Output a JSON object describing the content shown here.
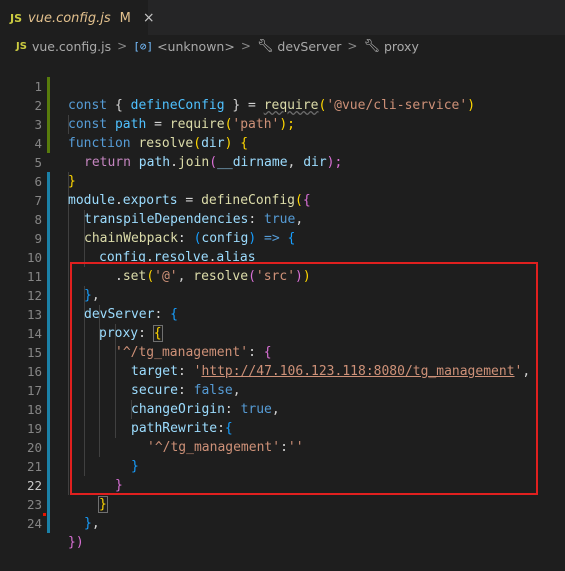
{
  "tab": {
    "badge": "JS",
    "title": "vue.config.js",
    "status": "M",
    "close": "×"
  },
  "breadcrumb": {
    "badge": "JS",
    "file": "vue.config.js",
    "sep": ">",
    "unknown_icon": "[⊘]",
    "unknown": "<unknown>",
    "devserver": "devServer",
    "proxy": "proxy"
  },
  "lines": [
    "1",
    "2",
    "3",
    "4",
    "5",
    "6",
    "7",
    "8",
    "9",
    "10",
    "11",
    "12",
    "13",
    "14",
    "15",
    "16",
    "17",
    "18",
    "19",
    "20",
    "21",
    "22",
    "23",
    "24"
  ],
  "code": {
    "l1": {
      "const": "const",
      "open": " { ",
      "name": "defineConfig",
      "close": " } ",
      "eq": "= ",
      "req": "require",
      "p1": "(",
      "str": "'@vue/cli-service'",
      "p2": ")"
    },
    "l2": {
      "const": "const",
      "var": " path",
      "eq": " = ",
      "req": "require",
      "p1": "(",
      "str": "'path'",
      "p2": ");"
    },
    "l3": {
      "kw": "function",
      "name": " resolve",
      "p1": "(",
      "arg": "dir",
      "p2": ")",
      "brace": " {"
    },
    "l4": {
      "kw": "return",
      "obj": " path",
      "dot": ".",
      "fn": "join",
      "p1": "(",
      "a1": "__dirname",
      "comma": ", ",
      "a2": "dir",
      "p2": ");"
    },
    "l5": {
      "brace": "}"
    },
    "l6": {
      "mod": "module",
      "dot": ".",
      "exp": "exports",
      "eq": " = ",
      "fn": "defineConfig",
      "p1": "(",
      "b": "{"
    },
    "l7": {
      "key": "transpileDependencies",
      "colon": ": ",
      "val": "true",
      "comma": ","
    },
    "l8": {
      "key": "chainWebpack",
      "colon": ": ",
      "p1": "(",
      "arg": "config",
      "p2": ")",
      "arrow": " => ",
      "b": "{"
    },
    "l9": {
      "obj": "config",
      "d1": ".",
      "p1": "resolve",
      "d2": ".",
      "p2": "alias"
    },
    "l10": {
      "dot": ".",
      "fn": "set",
      "p1": "(",
      "s1": "'@'",
      "comma": ", ",
      "fn2": "resolve",
      "p2": "(",
      "s2": "'src'",
      "p3": ")",
      "p4": ")"
    },
    "l11": {
      "b": "}",
      "comma": ","
    },
    "l12": {
      "key": "devServer",
      "colon": ": ",
      "b": "{"
    },
    "l13": {
      "key": "proxy",
      "colon": ": ",
      "b": "{"
    },
    "l14": {
      "str": "'^/tg_management'",
      "colon": ": ",
      "b": "{"
    },
    "l15": {
      "key": "target",
      "colon": ": ",
      "q1": "'",
      "url": "http://47.106.123.118:8080/tg_management",
      "q2": "'",
      "comma": ","
    },
    "l16": {
      "key": "secure",
      "colon": ": ",
      "val": "false",
      "comma": ","
    },
    "l17": {
      "key": "changeOrigin",
      "colon": ": ",
      "val": "true",
      "comma": ","
    },
    "l18": {
      "key": "pathRewrite",
      "colon": ":",
      "b": "{"
    },
    "l19": {
      "s1": "'^/tg_management'",
      "colon": ":",
      "s2": "''"
    },
    "l20": {
      "b": "}"
    },
    "l21": {
      "b": "}"
    },
    "l22": {
      "b": "}"
    },
    "l23": {
      "b": "}",
      "comma": ","
    },
    "l24": {
      "b": "})"
    }
  },
  "colors": {
    "highlight_box": "#e0201f",
    "keyword": "#569cd6",
    "string": "#ce9178"
  }
}
